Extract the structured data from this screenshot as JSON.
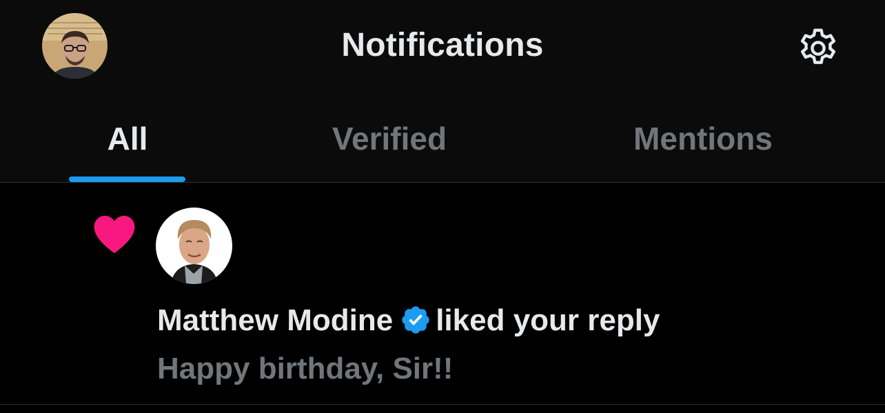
{
  "header": {
    "title": "Notifications",
    "avatar_icon": "user-avatar-icon",
    "settings_icon": "gear-icon"
  },
  "tabs": [
    {
      "label": "All",
      "selected": true
    },
    {
      "label": "Verified",
      "selected": false
    },
    {
      "label": "Mentions",
      "selected": false
    }
  ],
  "notifications": [
    {
      "type": "like",
      "icon": "heart-icon",
      "actor_name": "Matthew Modine",
      "actor_verified": true,
      "action": "liked your reply",
      "content": "Happy birthday, Sir!!"
    }
  ],
  "colors": {
    "background": "#000000",
    "header_background": "#0b0b0c",
    "primary_text": "#e7e9ea",
    "secondary_text": "#71767b",
    "accent_blue": "#1d9bf0",
    "like_pink": "#f91880",
    "divider": "#2f3336"
  }
}
